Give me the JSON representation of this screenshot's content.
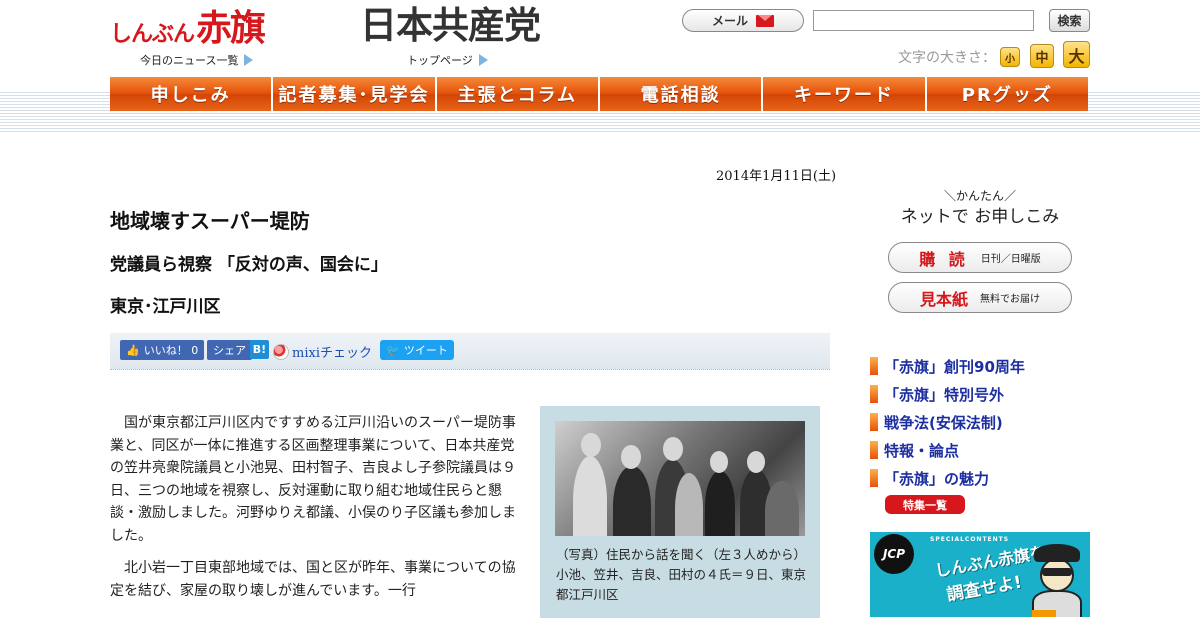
{
  "header": {
    "akahata_logo_small": "しんぶん",
    "akahata_logo_big": "赤旗",
    "news_list_link": "今日のニュース一覧",
    "jcp_logo": "日本共産党",
    "top_page_link": "トップページ",
    "mail_label": "メール",
    "search_value": "",
    "search_button": "検索",
    "font_size_label": "文字の大きさ：",
    "font_small": "小",
    "font_medium": "中",
    "font_large": "大"
  },
  "nav": {
    "items": [
      {
        "label": "申しこみ"
      },
      {
        "label": "記者募集･見学会"
      },
      {
        "label": "主張とコラム"
      },
      {
        "label": "電話相談"
      },
      {
        "label": "キーワード"
      },
      {
        "label": "PRグッズ"
      }
    ]
  },
  "article": {
    "date": "2014年1月11日(土)",
    "headline": "地域壊すスーパー堤防",
    "subhead": "党議員ら視察 「反対の声、国会に」",
    "location": "東京･江戸川区",
    "share": {
      "like": "いいね！ 0",
      "share": "シェア",
      "hatena": "B!",
      "mixi": "mixiチェック",
      "tweet": "ツイート"
    },
    "paragraphs": [
      "国が東京都江戸川区内ですすめる江戸川沿いのスーパー堤防事業と、同区が一体に推進する区画整理事業について、日本共産党の笠井亮衆院議員と小池晃、田村智子、吉良よし子参院議員は９日、三つの地域を視察し、反対運動に取り組む地域住民らと懇談・激励しました。河野ゆりえ都議、小俣のり子区議も参加しました。",
      "北小岩一丁目東部地域では、国と区が昨年、事業についての協定を結び、家屋の取り壊しが進んでいます。一行"
    ],
    "photo_caption": "（写真）住民から話を聞く（左３人めから）小池、笠井、吉良、田村の４氏＝９日、東京都江戸川区"
  },
  "sidebar": {
    "kantan": "＼かんたん／",
    "net_apply": "ネットで お申しこみ",
    "subscribe_big": "購 読",
    "subscribe_small": "日刊／日曜版",
    "sample_big": "見本紙",
    "sample_small": "無料でお届け",
    "links": [
      {
        "label": "「赤旗」創刊90周年"
      },
      {
        "label": "「赤旗」特別号外"
      },
      {
        "label": "戦争法(安保法制)"
      },
      {
        "label": "特報・論点"
      },
      {
        "label": "「赤旗」の魅力"
      }
    ],
    "tokushu_button": "特集一覧",
    "banner": {
      "jcp": "JCP",
      "special": "SPECIALCONTENTS",
      "line1": "しんぶん赤旗を",
      "line2": "調査せよ!"
    }
  },
  "colors": {
    "brand_red": "#d6171c",
    "nav_orange": "#e5520a",
    "link_blue": "#1d2fa0",
    "photo_box": "#c8dde3",
    "banner_cyan": "#1bb0c9"
  }
}
